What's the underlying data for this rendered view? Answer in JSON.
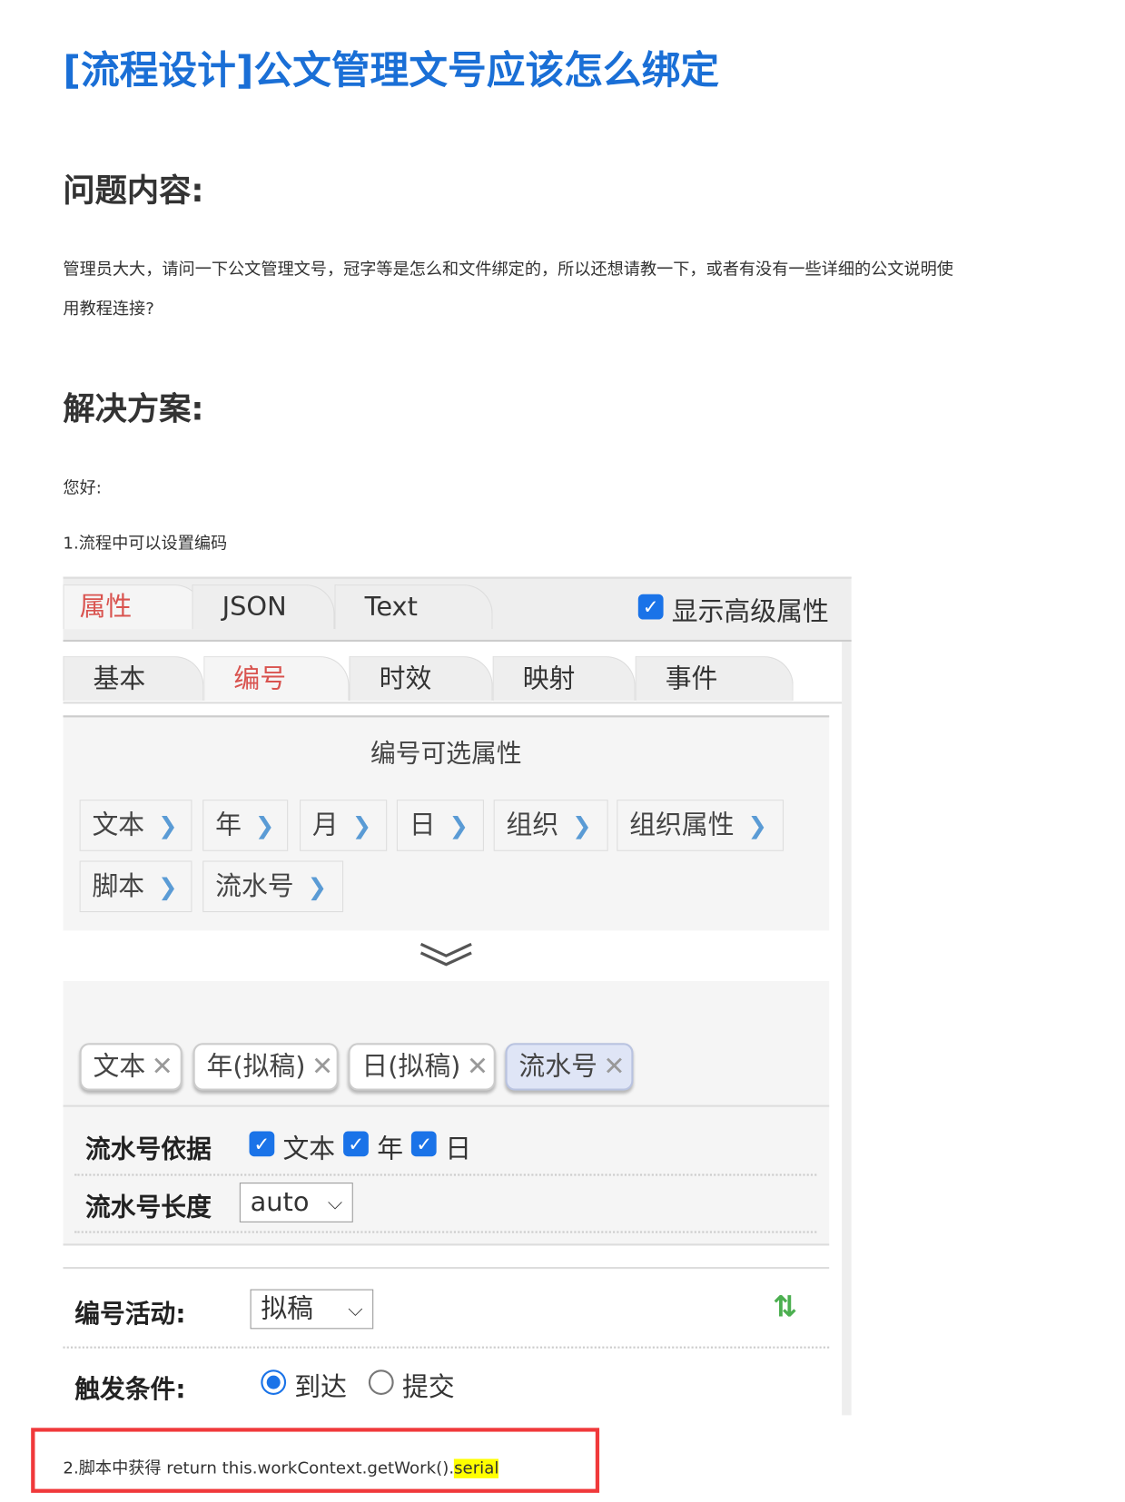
{
  "title": "[流程设计]公文管理文号应该怎么绑定",
  "question": {
    "heading": "问题内容:",
    "lines": [
      "管理员大大，请问一下公文管理文号，冠字等是怎么和文件绑定的，所以还想请教一下，或者有没有一些详细的公文说明使",
      "用教程连接?"
    ]
  },
  "solution": {
    "heading": "解决方案:",
    "greeting": "您好:",
    "step1": "1.流程中可以设置编码",
    "step2_prefix": "2.脚本中获得 return this.workContext.getWork().",
    "step2_highlight": "serial"
  },
  "panel": {
    "top_tabs": [
      "属性",
      "JSON",
      "Text"
    ],
    "show_advanced": {
      "label": "显示高级属性",
      "checked": true
    },
    "sub_tabs": [
      "基本",
      "编号",
      "时效",
      "映射",
      "事件"
    ],
    "active_sub_tab": "编号",
    "optional_title": "编号可选属性",
    "optional_items": [
      "文本",
      "年",
      "月",
      "日",
      "组织",
      "组织属性",
      "脚本",
      "流水号"
    ],
    "chips": [
      "文本",
      "年(拟稿)",
      "日(拟稿)",
      "流水号"
    ],
    "serial_basis": {
      "label": "流水号依据",
      "options": [
        "文本",
        "年",
        "日"
      ]
    },
    "serial_length": {
      "label": "流水号长度",
      "value": "auto"
    },
    "activity": {
      "label": "编号活动:",
      "value": "拟稿"
    },
    "trigger": {
      "label": "触发条件:",
      "options": [
        "到达",
        "提交"
      ],
      "selected": "到达"
    }
  },
  "colors": {
    "title": "#1a6fd6",
    "active_tab": "#d9534f",
    "highlight_box": "#f0393b",
    "checkbox": "#1a73e8"
  }
}
